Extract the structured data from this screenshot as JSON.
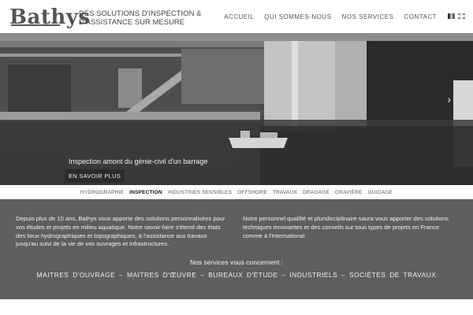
{
  "header": {
    "logo": "Bathys",
    "tagline_line1": "DES SOLUTIONS D'INSPECTION &",
    "tagline_line2": "D'ASSISTANCE SUR MESURE",
    "nav": [
      "ACCUEIL",
      "QUI SOMMES-NOUS",
      "NOS SERVICES",
      "CONTACT"
    ]
  },
  "hero": {
    "caption": "Inspection amont du génie-civil d'un barrage",
    "button": "EN SAVOIR PLUS",
    "next_icon": "chevron-right-icon"
  },
  "subnav": {
    "items": [
      "HYDROGRAPHIE",
      "INSPECTION",
      "INDUSTRIES SENSIBLES",
      "OFFSHORE",
      "TRAVAUX",
      "DRAGAGE",
      "GRAVIÈRE",
      "GUIDAGE"
    ],
    "active": "INSPECTION"
  },
  "content": {
    "left": "Depuis plus de 10 ans, Bathys vous apporte des solutions personnalisées pour vos études et projets en milieu aquatique. Notre savoir-faire s'étend des états des lieux hydrographiques et topographiques, à l'assistance aux travaux jusqu'au suivi de la vie de vos ouvrages et infrastructures.",
    "right": "Notre personnel qualifié et pluridisciplinaire saura vous apporter des solutions techniques innovantes et des conseils sur tous types de projets en France comme à l'International.",
    "concern": "Nos services vous concernent :",
    "clients": "MAITRES D'OUVRAGE – MAITRES D'ŒUVRE – BUREAUX D'ÉTUDE – INDUSTRIELS – SOCIÉTÉS DE TRAVAUX"
  }
}
